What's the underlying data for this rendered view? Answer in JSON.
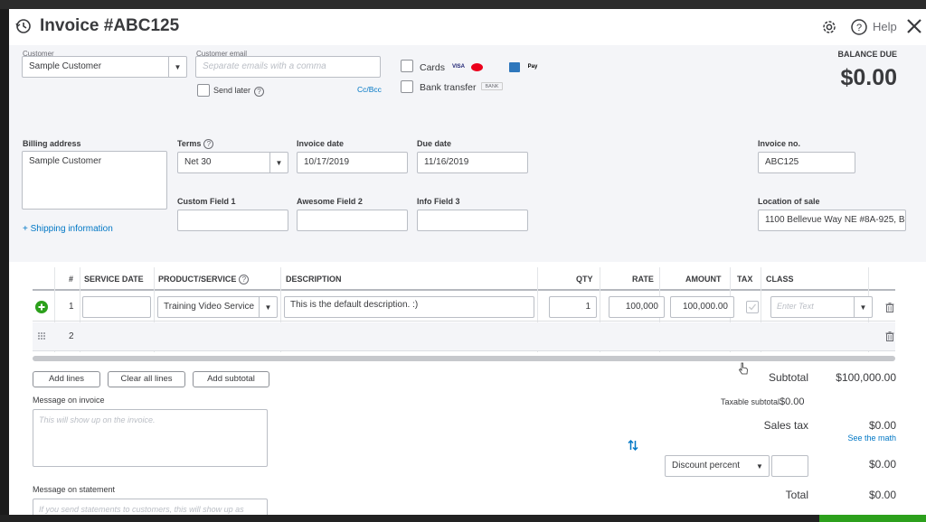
{
  "header": {
    "title": "Invoice #ABC125",
    "help_label": "Help"
  },
  "customer": {
    "label": "Customer",
    "value": "Sample Customer",
    "email_label": "Customer email",
    "email_placeholder": "Separate emails with a comma",
    "send_later_label": "Send later",
    "cc_bcc_label": "Cc/Bcc"
  },
  "payment": {
    "cards_label": "Cards",
    "bank_transfer_label": "Bank transfer",
    "card_logos": [
      "VISA",
      "MC",
      "DISCOVER",
      "AMEX",
      "Pay"
    ],
    "bank_logo": "BANK"
  },
  "balance": {
    "label": "BALANCE DUE",
    "value": "$0.00"
  },
  "billing": {
    "label": "Billing address",
    "value": "Sample Customer",
    "shipping_link": "+ Shipping information"
  },
  "terms": {
    "label": "Terms",
    "value": "Net 30"
  },
  "invoice_date": {
    "label": "Invoice date",
    "value": "10/17/2019"
  },
  "due_date": {
    "label": "Due date",
    "value": "11/16/2019"
  },
  "invoice_no": {
    "label": "Invoice no.",
    "value": "ABC125"
  },
  "custom_fields": [
    {
      "label": "Custom Field 1",
      "value": ""
    },
    {
      "label": "Awesome Field 2",
      "value": ""
    },
    {
      "label": "Info Field 3",
      "value": ""
    }
  ],
  "location": {
    "label": "Location of sale",
    "value": "1100 Bellevue Way NE #8A-925, B"
  },
  "table": {
    "headers": {
      "num": "#",
      "service_date": "SERVICE DATE",
      "product": "PRODUCT/SERVICE",
      "description": "DESCRIPTION",
      "qty": "QTY",
      "rate": "RATE",
      "amount": "AMOUNT",
      "tax": "TAX",
      "class": "CLASS"
    },
    "rows": [
      {
        "num": "1",
        "service_date": "",
        "product": "Training Video Service",
        "description": "This is the default description. :)",
        "qty": "1",
        "rate": "100,000",
        "amount": "100,000.00",
        "class_placeholder": "Enter Text"
      },
      {
        "num": "2"
      }
    ]
  },
  "buttons": {
    "add_lines": "Add lines",
    "clear_all": "Clear all lines",
    "add_subtotal": "Add subtotal"
  },
  "message_invoice": {
    "label": "Message on invoice",
    "placeholder": "This will show up on the invoice."
  },
  "message_statement": {
    "label": "Message on statement",
    "placeholder": "If you send statements to customers, this will show up as"
  },
  "totals": {
    "subtotal_label": "Subtotal",
    "subtotal_value": "$100,000.00",
    "taxable_label": "Taxable subtotal",
    "taxable_value": "$0.00",
    "sales_tax_label": "Sales tax",
    "sales_tax_value": "$0.00",
    "see_math": "See the math",
    "discount_option": "Discount percent",
    "discount_value": "$0.00",
    "total_label": "Total",
    "total_value": "$0.00"
  }
}
